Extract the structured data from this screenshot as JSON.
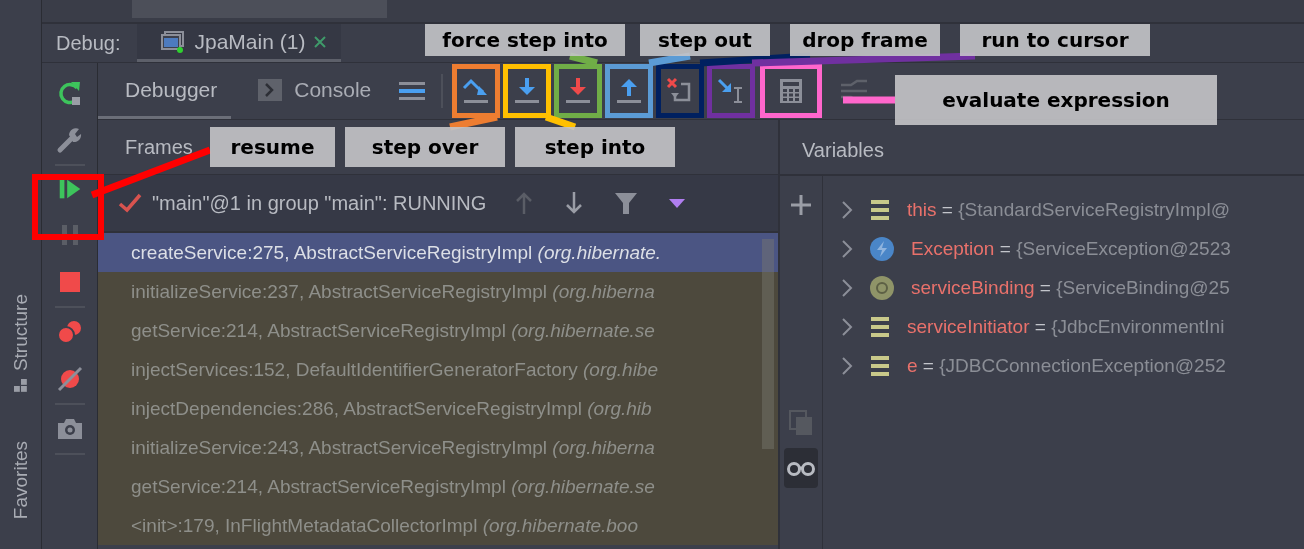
{
  "debug_header": {
    "label": "Debug:",
    "sessions": [
      {
        "label": "JpaMain (1)",
        "selected": true
      }
    ]
  },
  "side_tabs": [
    {
      "label": "Structure"
    },
    {
      "label": "Favorites"
    }
  ],
  "debugger_tabs": [
    {
      "label": "Debugger",
      "selected": true
    },
    {
      "label": "Console",
      "selected": false
    }
  ],
  "frames": {
    "title": "Frames",
    "thread": "\"main\"@1 in group \"main\": RUNNING",
    "rows": [
      {
        "text": "createService:275, AbstractServiceRegistryImpl *(org.hibernate.*",
        "selected": true,
        "library": true
      },
      {
        "text": "initializeService:237, AbstractServiceRegistryImpl *(org.hiberna*",
        "selected": false,
        "library": true
      },
      {
        "text": "getService:214, AbstractServiceRegistryImpl *(org.hibernate.se*",
        "selected": false,
        "library": true
      },
      {
        "text": "injectServices:152, DefaultIdentifierGeneratorFactory *(org.hibe*",
        "selected": false,
        "library": true
      },
      {
        "text": "injectDependencies:286, AbstractServiceRegistryImpl *(org.hib*",
        "selected": false,
        "library": true
      },
      {
        "text": "initializeService:243, AbstractServiceRegistryImpl *(org.hiberna*",
        "selected": false,
        "library": true
      },
      {
        "text": "getService:214, AbstractServiceRegistryImpl *(org.hibernate.se*",
        "selected": false,
        "library": true
      },
      {
        "text": "<init>:179, InFlightMetadataCollectorImpl *(org.hibernate.boo*",
        "selected": false,
        "library": true
      }
    ]
  },
  "variables": {
    "title": "Variables",
    "glasses_toggle_on": true,
    "rows": [
      {
        "kind": "field",
        "name": "this",
        "separator": "=",
        "value": "{StandardServiceRegistryImpl@"
      },
      {
        "kind": "exception",
        "name": "Exception",
        "separator": "=",
        "value": "{ServiceException@2523"
      },
      {
        "kind": "parameter",
        "name": "serviceBinding",
        "separator": "=",
        "value": "{ServiceBinding@25"
      },
      {
        "kind": "field",
        "name": "serviceInitiator",
        "separator": "=",
        "value": "{JdbcEnvironmentIni"
      },
      {
        "kind": "field",
        "name": "e",
        "separator": "=",
        "value": "{JDBCConnectionException@252"
      }
    ]
  },
  "annotations": [
    {
      "label": "step over",
      "color": "#ed7d31"
    },
    {
      "label": "step into",
      "color": "#ffc000"
    },
    {
      "label": "force step into",
      "color": "#70ad47"
    },
    {
      "label": "step out",
      "color": "#5b9bd5"
    },
    {
      "label": "drop frame",
      "color": "#002060"
    },
    {
      "label": "run to cursor",
      "color": "#7030a0"
    },
    {
      "label": "evaluate expression",
      "color": "#ff66cc"
    },
    {
      "label": "resume",
      "color": "#ff0000"
    }
  ]
}
